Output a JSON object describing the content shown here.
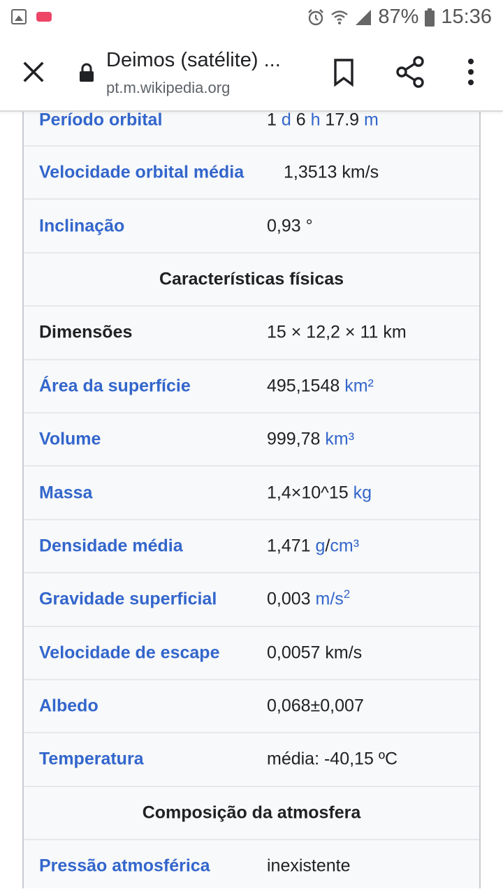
{
  "status_bar": {
    "battery": "87%",
    "time": "15:36",
    "icons": [
      "gallery-icon",
      "app-notification-icon",
      "alarm-icon",
      "wifi-icon",
      "signal-icon",
      "battery-icon"
    ]
  },
  "toolbar": {
    "title": "Deimos (satélite) ...",
    "url": "pt.m.wikipedia.org",
    "icons": [
      "close-icon",
      "lock-icon",
      "bookmark-icon",
      "share-icon",
      "more-vert-icon"
    ]
  },
  "infobox": {
    "orbital": [
      {
        "label": "Período orbital",
        "v1": "1 ",
        "v2": "d",
        "v3": " 6 ",
        "v4": "h",
        "v5": " 17.9 ",
        "v6": "m"
      },
      {
        "label": "Velocidade orbital média",
        "value": "1,3513 km/s"
      },
      {
        "label": "Inclinação",
        "value": "0,93 °"
      }
    ],
    "section_physical": "Características físicas",
    "physical": {
      "dimensoes_label": "Dimensões",
      "dimensoes_value": "15 × 12,2 × 11 km",
      "area_label": "Área da superfície",
      "area_value": "495,1548 ",
      "area_unit": "km²",
      "volume_label": "Volume",
      "volume_value": "999,78 ",
      "volume_unit": "km³",
      "massa_label": "Massa",
      "massa_value": "1,4×10^15 ",
      "massa_unit": "kg",
      "densidade_label": "Densidade média",
      "densidade_value": "1,471 ",
      "densidade_unit_g": "g",
      "densidade_sep": "/",
      "densidade_unit_cm": "cm³",
      "gravidade_label": "Gravidade superficial",
      "gravidade_value": "0,003 ",
      "gravidade_unit": "m/s",
      "gravidade_exp": "2",
      "escape_label": "Velocidade de escape",
      "escape_value": "0,0057 km/s",
      "albedo_label": "Albedo",
      "albedo_value": "0,068±0,007",
      "temperatura_label": "Temperatura",
      "temperatura_value": "média: -40,15 ºC"
    },
    "section_atmosphere": "Composição da atmosfera",
    "atmosphere": {
      "pressao_label": "Pressão atmosférica",
      "pressao_value": "inexistente"
    }
  }
}
